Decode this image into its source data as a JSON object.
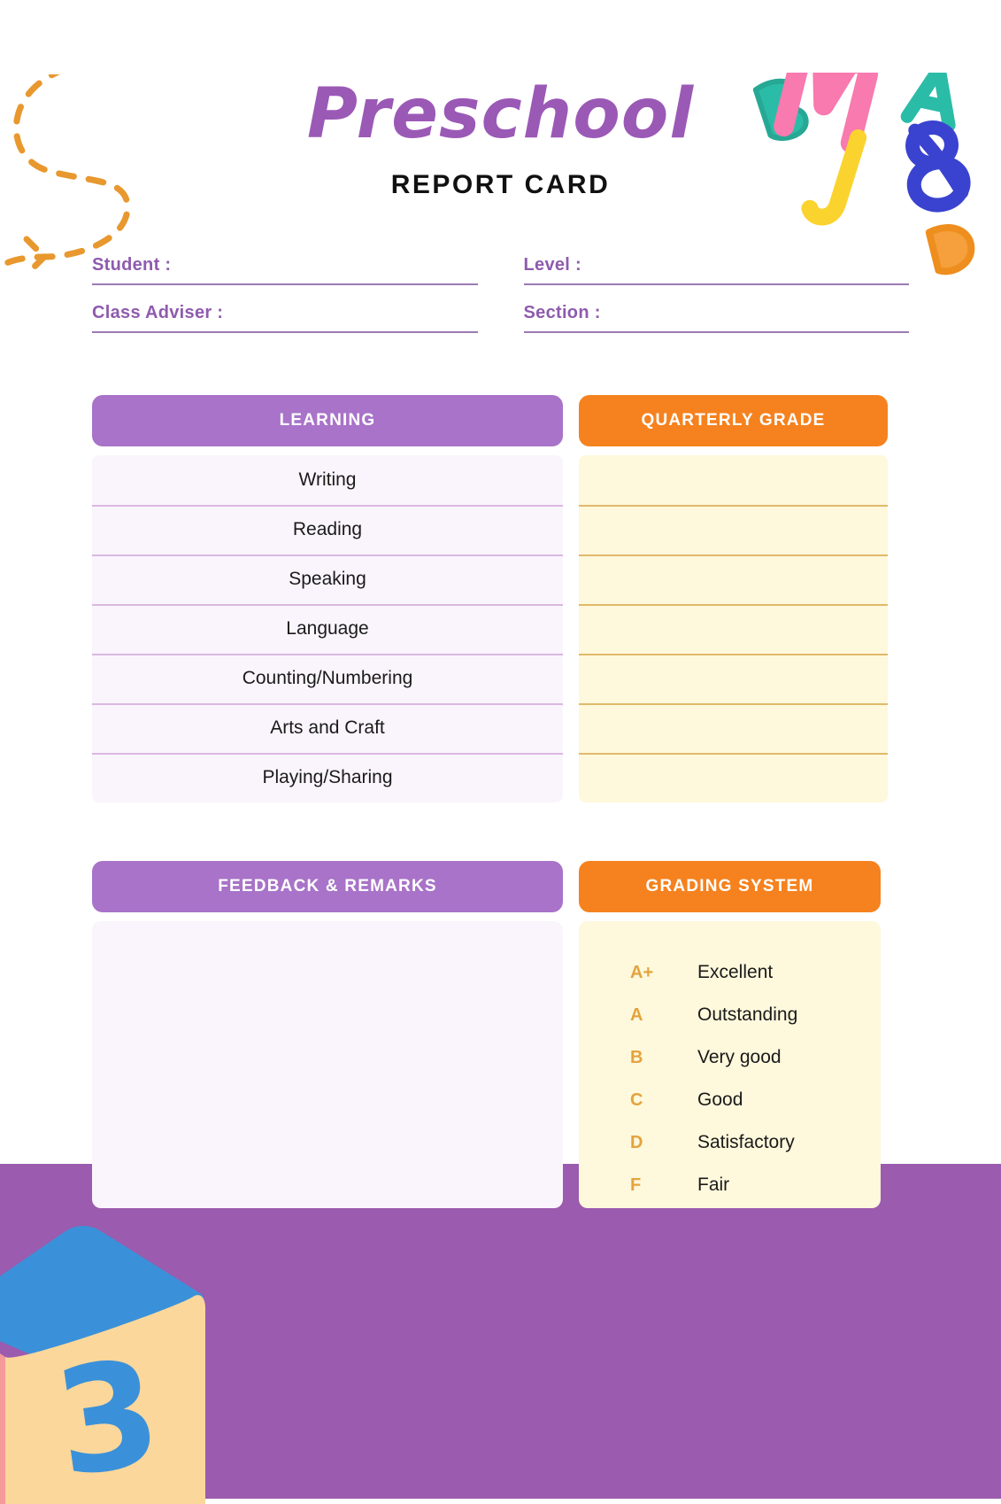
{
  "document": {
    "title": "Preschool",
    "subtitle": "REPORT CARD"
  },
  "form": {
    "left": [
      {
        "label": "Student :",
        "value": ""
      },
      {
        "label": "Class Adviser :",
        "value": ""
      }
    ],
    "right": [
      {
        "label": "Level :",
        "value": ""
      },
      {
        "label": "Section :",
        "value": ""
      }
    ]
  },
  "table": {
    "learning_header": "LEARNING",
    "grade_header": "QUARTERLY GRADE",
    "subjects": [
      "Writing",
      "Reading",
      "Speaking",
      "Language",
      "Counting/Numbering",
      "Arts and Craft",
      "Playing/Sharing"
    ],
    "grades": [
      "",
      "",
      "",
      "",
      "",
      "",
      ""
    ]
  },
  "feedback": {
    "header": "FEEDBACK & REMARKS",
    "value": ""
  },
  "grading": {
    "header": "GRADING SYSTEM",
    "items": [
      {
        "key": "A+",
        "desc": "Excellent"
      },
      {
        "key": "A",
        "desc": "Outstanding"
      },
      {
        "key": "B",
        "desc": "Very good"
      },
      {
        "key": "C",
        "desc": "Good"
      },
      {
        "key": "D",
        "desc": "Satisfactory"
      },
      {
        "key": "F",
        "desc": "Fair"
      }
    ]
  },
  "decorations": {
    "swirl": "dashed-swirl-arrow",
    "letters": [
      "B",
      "M",
      "A",
      "J",
      "8",
      "D"
    ],
    "block_number": "3"
  },
  "colors": {
    "title_purple": "#9B59B6",
    "header_purple": "#A873C8",
    "header_orange": "#F5821F",
    "band_purple": "#9B5BAE",
    "lavender_bg": "#FAF5FD",
    "cream_bg": "#FEF8DC",
    "grade_key": "#E5A33D",
    "divider_purple": "#D9B8E0",
    "divider_gold": "#E0B96A",
    "label_purple": "#8E5BAE",
    "deco_teal": "#2BBCA8",
    "deco_pink": "#F87AAF",
    "deco_yellow": "#FBD32E",
    "deco_blue": "#3A43CF",
    "deco_orange": "#F5A03C",
    "block_blue": "#3A91D9",
    "block_cream": "#FBD79B",
    "block_pink": "#F59A9A"
  }
}
